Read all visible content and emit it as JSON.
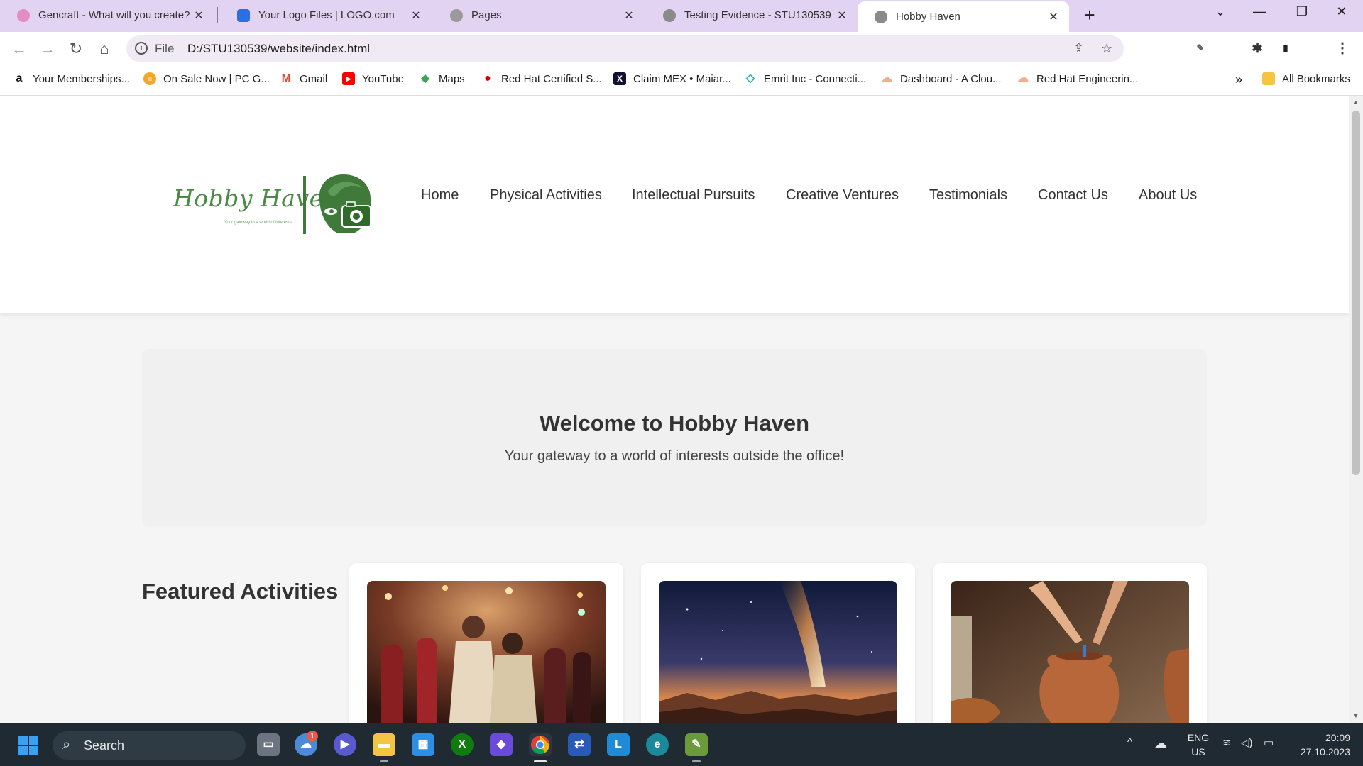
{
  "browser": {
    "tabs": [
      {
        "title": "Gencraft - What will you create?",
        "active": false,
        "icon_color": "#d94f9a"
      },
      {
        "title": "Your Logo Files | LOGO.com",
        "active": false,
        "icon_color": "#2c6fe0"
      },
      {
        "title": "Pages",
        "active": false,
        "icon_color": "#888888"
      },
      {
        "title": "Testing Evidence - STU130539",
        "active": false,
        "icon_color": "#777777"
      },
      {
        "title": "Hobby Haven",
        "active": true,
        "icon_color": "#777777"
      }
    ],
    "new_tab": "+",
    "window_controls": {
      "minimize": "—",
      "restore": "❐",
      "close": "✕",
      "tab_search": "⌄"
    },
    "toolbar": {
      "back": "←",
      "forward": "→",
      "reload": "↻",
      "home": "⌂",
      "scheme": "File",
      "url": "D:/STU130539/website/index.html",
      "share": "⇪",
      "star": "☆"
    },
    "extensions": [
      {
        "name": "opera-icon",
        "glyph": "O",
        "color": "#e0262d"
      },
      {
        "name": "grammarly-icon",
        "glyph": "G",
        "color": "#15c39a"
      },
      {
        "name": "pen-icon",
        "glyph": "✎",
        "color": "#555555"
      },
      {
        "name": "r-icon",
        "glyph": "R",
        "color": "#aaaaaa"
      },
      {
        "name": "puzzle-icon",
        "glyph": "✱",
        "color": "#333333"
      },
      {
        "name": "sidepanel-icon",
        "glyph": "▮",
        "color": "#222222"
      },
      {
        "name": "profile-avatar",
        "glyph": "☺",
        "color": "#7a5a40"
      },
      {
        "name": "menu-icon",
        "glyph": "⋮",
        "color": "#333333"
      }
    ],
    "bookmarks": [
      {
        "label": "Your Memberships...",
        "icon": "a",
        "color": "#111111"
      },
      {
        "label": "On Sale Now | PC G...",
        "icon": "≡",
        "color": "#f5a623"
      },
      {
        "label": "Gmail",
        "icon": "M",
        "color": "#ea4335"
      },
      {
        "label": "YouTube",
        "icon": "▶",
        "color": "#ff0000"
      },
      {
        "label": "Maps",
        "icon": "◆",
        "color": "#34a853"
      },
      {
        "label": "Red Hat Certified S...",
        "icon": "●",
        "color": "#cc0000"
      },
      {
        "label": "Claim MEX • Maiar...",
        "icon": "X",
        "color": "#111133"
      },
      {
        "label": "Emrit Inc - Connecti...",
        "icon": "◇",
        "color": "#20b2aa"
      },
      {
        "label": "Dashboard - A Clou...",
        "icon": "☁",
        "color": "#f0b090"
      },
      {
        "label": "Red Hat Engineerin...",
        "icon": "☁",
        "color": "#f0b090"
      }
    ],
    "bookmarks_overflow": "»",
    "all_bookmarks": "All Bookmarks"
  },
  "site": {
    "logo_text": "Hobby Haven",
    "logo_tagline": "Your gateway to a world of interests",
    "nav": [
      "Home",
      "Physical Activities",
      "Intellectual Pursuits",
      "Creative Ventures",
      "Testimonials",
      "Contact Us",
      "About Us"
    ],
    "hero": {
      "title": "Welcome to Hobby Haven",
      "subtitle": "Your gateway to a world of interests outside the office!"
    },
    "featured_title": "Featured Activities",
    "cards": [
      {
        "image": "dancing-couple-photo"
      },
      {
        "image": "milky-way-landscape-photo"
      },
      {
        "image": "pottery-making-photo"
      }
    ]
  },
  "taskbar": {
    "search_label": "Search",
    "weather_badge": "1",
    "tray_language": [
      "ENG",
      "US"
    ],
    "clock_time": "20:09",
    "clock_date": "27.10.2023",
    "tray_chevron": "^"
  }
}
